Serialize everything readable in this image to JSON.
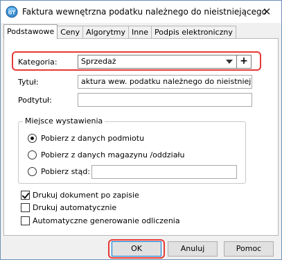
{
  "window": {
    "title": "Faktura wewnętrzna podatku należnego do nieistniejącego",
    "close_symbol": "✕"
  },
  "tabs": [
    {
      "label": "Podstawowe",
      "active": true
    },
    {
      "label": "Ceny",
      "active": false
    },
    {
      "label": "Algorytmy",
      "active": false
    },
    {
      "label": "Inne",
      "active": false
    },
    {
      "label": "Podpis elektroniczny",
      "active": false
    }
  ],
  "form": {
    "kategoria_label": "Kategoria:",
    "kategoria_value": "Sprzedaż",
    "add_symbol": "+",
    "tytul_label": "Tytuł:",
    "tytul_value": "aktura wew. podatku należnego do nieistniejącego",
    "podtytul_label": "Podtytuł:",
    "podtytul_value": ""
  },
  "miejsce": {
    "legend": "Miejsce wystawienia",
    "options": [
      {
        "label": "Pobierz z danych podmiotu",
        "checked": true
      },
      {
        "label": "Pobierz z danych magazynu /oddziału",
        "checked": false
      },
      {
        "label": "Pobierz stąd:",
        "checked": false
      }
    ],
    "stad_value": ""
  },
  "checkboxes": [
    {
      "label": "Drukuj dokument po zapisie",
      "checked": true
    },
    {
      "label": "Drukuj automatycznie",
      "checked": false
    },
    {
      "label": "Automatyczne generowanie odliczenia",
      "checked": false
    }
  ],
  "buttons": {
    "ok": "OK",
    "cancel": "Anuluj",
    "help": "Pomoc"
  },
  "colors": {
    "highlight": "#e53935",
    "default_button_border": "#0078d7",
    "window_border": "#6b8fb8"
  },
  "icons": {
    "app": "gt-app-icon",
    "close": "close-icon",
    "dropdown": "chevron-down-icon",
    "add": "plus-icon"
  }
}
